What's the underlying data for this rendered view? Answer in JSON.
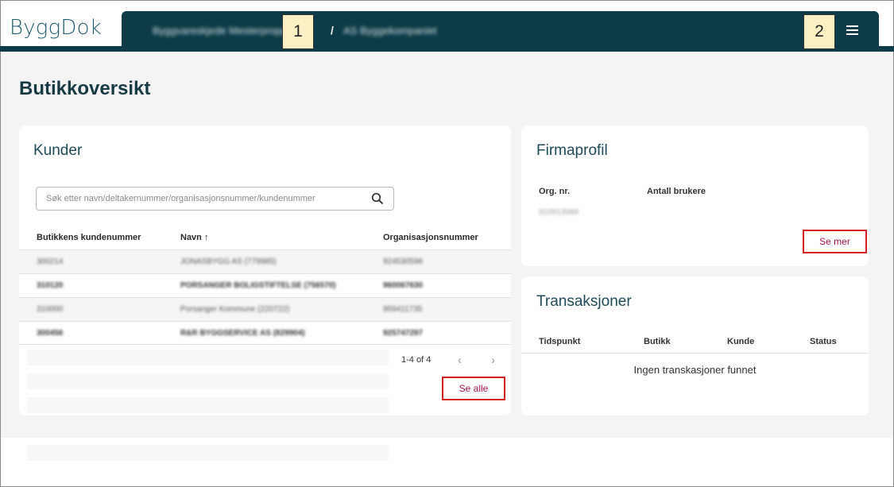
{
  "header": {
    "logo": "ByggDok",
    "breadcrumb": [
      "Byggvareskjede Mesterproppen",
      "/",
      "AS Byggekompaniet"
    ],
    "menu_icon": "hamburger-menu-icon"
  },
  "callouts": [
    "1",
    "2"
  ],
  "page": {
    "title": "Butikkoversikt"
  },
  "kunder": {
    "title": "Kunder",
    "search_placeholder": "Søk etter navn/deltakernummer/organisasjonsnummer/kundenummer",
    "columns": [
      "Butikkens kundenummer",
      "Navn ↑",
      "Organisasjonsnummer"
    ],
    "rows": [
      [
        "300214",
        "JONASBYGG AS (779985)",
        "924530596"
      ],
      [
        "310120",
        "PORSANGER BOLIGSTIFTELSE (756570)",
        "960067630"
      ],
      [
        "310000",
        "Porsanger Kommune (220722)",
        "959411735"
      ],
      [
        "300456",
        "R&R BYGGSERVICE AS (829904)",
        "925747297"
      ]
    ],
    "pagination": "1-4 of 4",
    "see_all": "Se alle"
  },
  "firmaprofil": {
    "title": "Firmaprofil",
    "org_label": "Org. nr.",
    "org_value": "910913088",
    "users_label": "Antall brukere",
    "see_more": "Se mer"
  },
  "transaksjoner": {
    "title": "Transaksjoner",
    "columns": [
      "Tidspunkt",
      "Butikk",
      "Kunde",
      "Status"
    ],
    "empty": "Ingen transkasjoner funnet"
  },
  "colors": {
    "header_bg": "#0d3b47",
    "accent": "#a3144a",
    "highlight_border": "#d62020"
  }
}
